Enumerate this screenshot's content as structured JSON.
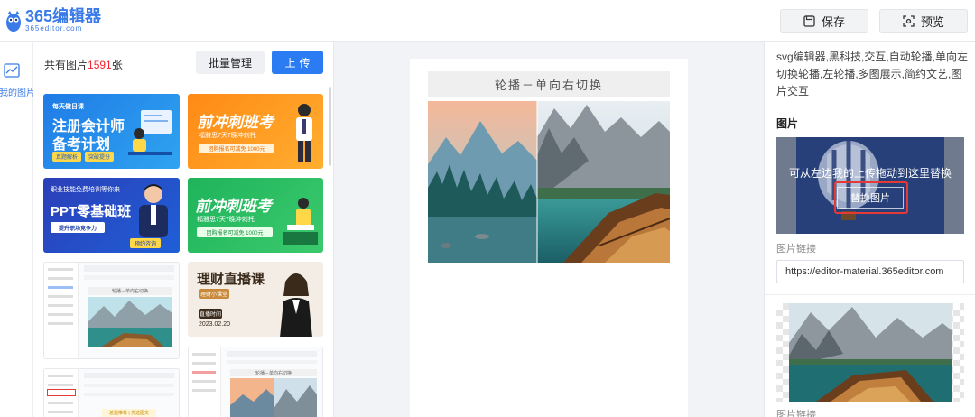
{
  "app": {
    "logo_name": "365编辑器",
    "logo_sub": "365editor.com",
    "brand_color": "#3a7be8"
  },
  "toolbar": {
    "save_label": "保存",
    "preview_label": "预览",
    "save_icon": "save-icon",
    "preview_icon": "preview-icon"
  },
  "rail": {
    "items": [
      {
        "label": "我的图片",
        "icon": "image-chart-icon"
      }
    ]
  },
  "panel": {
    "count_prefix": "共有图片",
    "count_value": "1591",
    "count_suffix": "张",
    "batch_label": "批量管理",
    "upload_label": "上传",
    "thumbnails": {
      "t1": {
        "tag": "每天做日课",
        "title1": "注册会计师",
        "title2": "备考计划",
        "pill1": "真题解析",
        "pill2": "突破提分"
      },
      "t2": {
        "title": "前冲刺班考",
        "sub": "福雅思7天7晚冲刺托",
        "pill": "团购报名可减免 1000元"
      },
      "t3": {
        "tag": "职业技能免费培训等你来",
        "title": "PPT零基础班",
        "sub": "提升职场竞争力",
        "pill": "预约咨询"
      },
      "t4": {
        "title": "前冲刺班考",
        "sub": "福雅思7天7晚冲刺托",
        "pill": "团购报名可减免 1000元"
      },
      "t5": {
        "head": "轮播－单向右切换"
      },
      "t6": {
        "title": "理财直播课",
        "pill1": "理财小课堂",
        "pill2": "直播时间",
        "date": "2023.02.20"
      },
      "t7": {
        "head": "总监推荐 | 优选图文"
      },
      "t8": {
        "head": "轮播－单向右切换"
      }
    }
  },
  "canvas": {
    "carousel_title": "轮播－单向右切换"
  },
  "props": {
    "tags_text": "svg编辑器,黑科技,交互,自动轮播,单向左切换轮播,左轮播,多图展示,简约文艺,图片交互",
    "image_section_title": "图片",
    "replace_hint": "可从左边我的上传拖动到这里替换",
    "replace_button": "替换图片",
    "link_label": "图片链接",
    "link_value": "https://editor-material.365editor.com",
    "link_label_2": "图片链接"
  }
}
